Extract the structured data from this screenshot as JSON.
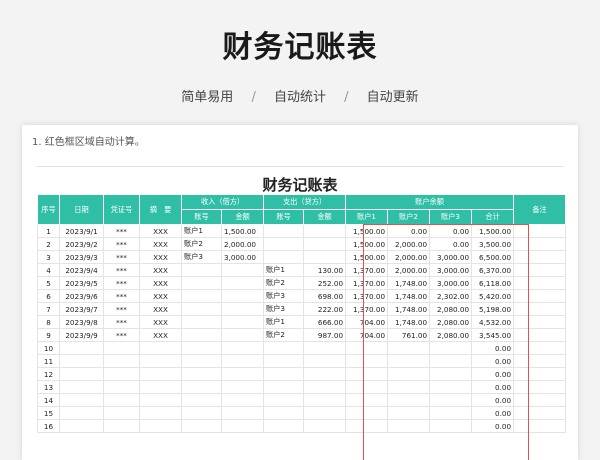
{
  "hero": {
    "title": "财务记账表",
    "features": [
      "简单易用",
      "自动统计",
      "自动更新"
    ],
    "separator": "/"
  },
  "sheet": {
    "note": "1. 红色框区域自动计算。",
    "title": "财务记账表",
    "headers": {
      "seq": "序号",
      "date": "日期",
      "voucher": "凭证号",
      "summary": "摘　要",
      "income": "收入（借方）",
      "expense": "支出（贷方）",
      "balance": "账户余额",
      "remark": "备注",
      "account": "账号",
      "amount": "金额",
      "acct1": "账户1",
      "acct2": "账户2",
      "acct3": "账户3",
      "total": "合计"
    },
    "rows": [
      {
        "seq": "1",
        "date": "2023/9/1",
        "voucher": "***",
        "summary": "XXX",
        "in_acct": "账户1",
        "in_amt": "1,500.00",
        "out_acct": "",
        "out_amt": "",
        "b1": "1,500.00",
        "b2": "0.00",
        "b3": "0.00",
        "total": "1,500.00"
      },
      {
        "seq": "2",
        "date": "2023/9/2",
        "voucher": "***",
        "summary": "XXX",
        "in_acct": "账户2",
        "in_amt": "2,000.00",
        "out_acct": "",
        "out_amt": "",
        "b1": "1,500.00",
        "b2": "2,000.00",
        "b3": "0.00",
        "total": "3,500.00"
      },
      {
        "seq": "3",
        "date": "2023/9/3",
        "voucher": "***",
        "summary": "XXX",
        "in_acct": "账户3",
        "in_amt": "3,000.00",
        "out_acct": "",
        "out_amt": "",
        "b1": "1,500.00",
        "b2": "2,000.00",
        "b3": "3,000.00",
        "total": "6,500.00"
      },
      {
        "seq": "4",
        "date": "2023/9/4",
        "voucher": "***",
        "summary": "XXX",
        "in_acct": "",
        "in_amt": "",
        "out_acct": "账户1",
        "out_amt": "130.00",
        "b1": "1,370.00",
        "b2": "2,000.00",
        "b3": "3,000.00",
        "total": "6,370.00"
      },
      {
        "seq": "5",
        "date": "2023/9/5",
        "voucher": "***",
        "summary": "XXX",
        "in_acct": "",
        "in_amt": "",
        "out_acct": "账户2",
        "out_amt": "252.00",
        "b1": "1,370.00",
        "b2": "1,748.00",
        "b3": "3,000.00",
        "total": "6,118.00"
      },
      {
        "seq": "6",
        "date": "2023/9/6",
        "voucher": "***",
        "summary": "XXX",
        "in_acct": "",
        "in_amt": "",
        "out_acct": "账户3",
        "out_amt": "698.00",
        "b1": "1,370.00",
        "b2": "1,748.00",
        "b3": "2,302.00",
        "total": "5,420.00"
      },
      {
        "seq": "7",
        "date": "2023/9/7",
        "voucher": "***",
        "summary": "XXX",
        "in_acct": "",
        "in_amt": "",
        "out_acct": "账户3",
        "out_amt": "222.00",
        "b1": "1,370.00",
        "b2": "1,748.00",
        "b3": "2,080.00",
        "total": "5,198.00"
      },
      {
        "seq": "8",
        "date": "2023/9/8",
        "voucher": "***",
        "summary": "XXX",
        "in_acct": "",
        "in_amt": "",
        "out_acct": "账户1",
        "out_amt": "666.00",
        "b1": "704.00",
        "b2": "1,748.00",
        "b3": "2,080.00",
        "total": "4,532.00"
      },
      {
        "seq": "9",
        "date": "2023/9/9",
        "voucher": "***",
        "summary": "XXX",
        "in_acct": "",
        "in_amt": "",
        "out_acct": "账户2",
        "out_amt": "987.00",
        "b1": "704.00",
        "b2": "761.00",
        "b3": "2,080.00",
        "total": "3,545.00"
      },
      {
        "seq": "10",
        "date": "",
        "voucher": "",
        "summary": "",
        "in_acct": "",
        "in_amt": "",
        "out_acct": "",
        "out_amt": "",
        "b1": "",
        "b2": "",
        "b3": "",
        "total": "0.00"
      },
      {
        "seq": "11",
        "date": "",
        "voucher": "",
        "summary": "",
        "in_acct": "",
        "in_amt": "",
        "out_acct": "",
        "out_amt": "",
        "b1": "",
        "b2": "",
        "b3": "",
        "total": "0.00"
      },
      {
        "seq": "12",
        "date": "",
        "voucher": "",
        "summary": "",
        "in_acct": "",
        "in_amt": "",
        "out_acct": "",
        "out_amt": "",
        "b1": "",
        "b2": "",
        "b3": "",
        "total": "0.00"
      },
      {
        "seq": "13",
        "date": "",
        "voucher": "",
        "summary": "",
        "in_acct": "",
        "in_amt": "",
        "out_acct": "",
        "out_amt": "",
        "b1": "",
        "b2": "",
        "b3": "",
        "total": "0.00"
      },
      {
        "seq": "14",
        "date": "",
        "voucher": "",
        "summary": "",
        "in_acct": "",
        "in_amt": "",
        "out_acct": "",
        "out_amt": "",
        "b1": "",
        "b2": "",
        "b3": "",
        "total": "0.00"
      },
      {
        "seq": "15",
        "date": "",
        "voucher": "",
        "summary": "",
        "in_acct": "",
        "in_amt": "",
        "out_acct": "",
        "out_amt": "",
        "b1": "",
        "b2": "",
        "b3": "",
        "total": "0.00"
      },
      {
        "seq": "16",
        "date": "",
        "voucher": "",
        "summary": "",
        "in_acct": "",
        "in_amt": "",
        "out_acct": "",
        "out_amt": "",
        "b1": "",
        "b2": "",
        "b3": "",
        "total": "0.00"
      }
    ]
  },
  "colors": {
    "header_bg": "#2fbfa6",
    "highlight_border": "#e05252"
  }
}
